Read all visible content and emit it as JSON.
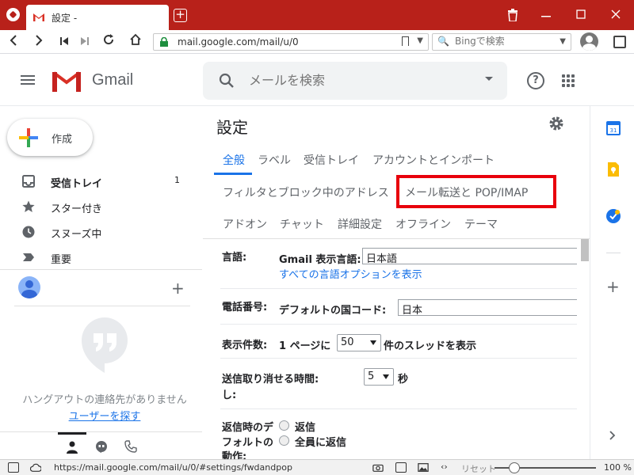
{
  "browser": {
    "tab_title": "設定 -",
    "url": "mail.google.com/mail/u/0",
    "search_placeholder": "Bingで検索"
  },
  "header": {
    "app_name": "Gmail",
    "search_placeholder": "メールを検索"
  },
  "sidebar": {
    "compose_label": "作成",
    "items": [
      {
        "label": "受信トレイ",
        "count": "1",
        "icon": "inbox-icon"
      },
      {
        "label": "スター付き",
        "count": "",
        "icon": "star-icon"
      },
      {
        "label": "スヌーズ中",
        "count": "",
        "icon": "clock-icon"
      },
      {
        "label": "重要",
        "count": "",
        "icon": "important-icon"
      }
    ],
    "hangouts_empty": "ハングアウトの連絡先がありません",
    "hangouts_link": "ユーザーを探す"
  },
  "settings": {
    "title": "設定",
    "tabs_row1": [
      "全般",
      "ラベル",
      "受信トレイ",
      "アカウントとインポート"
    ],
    "tabs_row2": [
      "フィルタとブロック中のアドレス",
      "メール転送と POP/IMAP"
    ],
    "tabs_row3": [
      "アドオン",
      "チャット",
      "詳細設定",
      "オフライン",
      "テーマ"
    ],
    "language": {
      "label": "言語:",
      "display_label": "Gmail 表示言語:",
      "value": "日本語",
      "link": "すべての言語オプションを表示"
    },
    "phone": {
      "label": "電話番号:",
      "country_label": "デフォルトの国コード:",
      "value": "日本"
    },
    "page_size": {
      "label": "表示件数:",
      "prefix": "1 ページに",
      "value": "50",
      "suffix": "件のスレッドを表示"
    },
    "undo_send": {
      "label_line1": "送信取り消せる時間:",
      "label_line2": "し:",
      "label_prefix": "送信取り消",
      "value": "5",
      "unit": "秒"
    },
    "reply": {
      "label_line1": "返信時のデ",
      "label_line2": "フォルトの",
      "label_line3": "動作:",
      "option1": "返信",
      "option2": "全員に返信"
    }
  },
  "statusbar": {
    "url": "https://mail.google.com/mail/u/0/#settings/fwdandpop",
    "reset": "リセット",
    "zoom": "100 %"
  },
  "colors": {
    "vivaldi_red": "#b8211a",
    "gmail_blue": "#1a73e8",
    "highlight_red": "#e8000c"
  }
}
